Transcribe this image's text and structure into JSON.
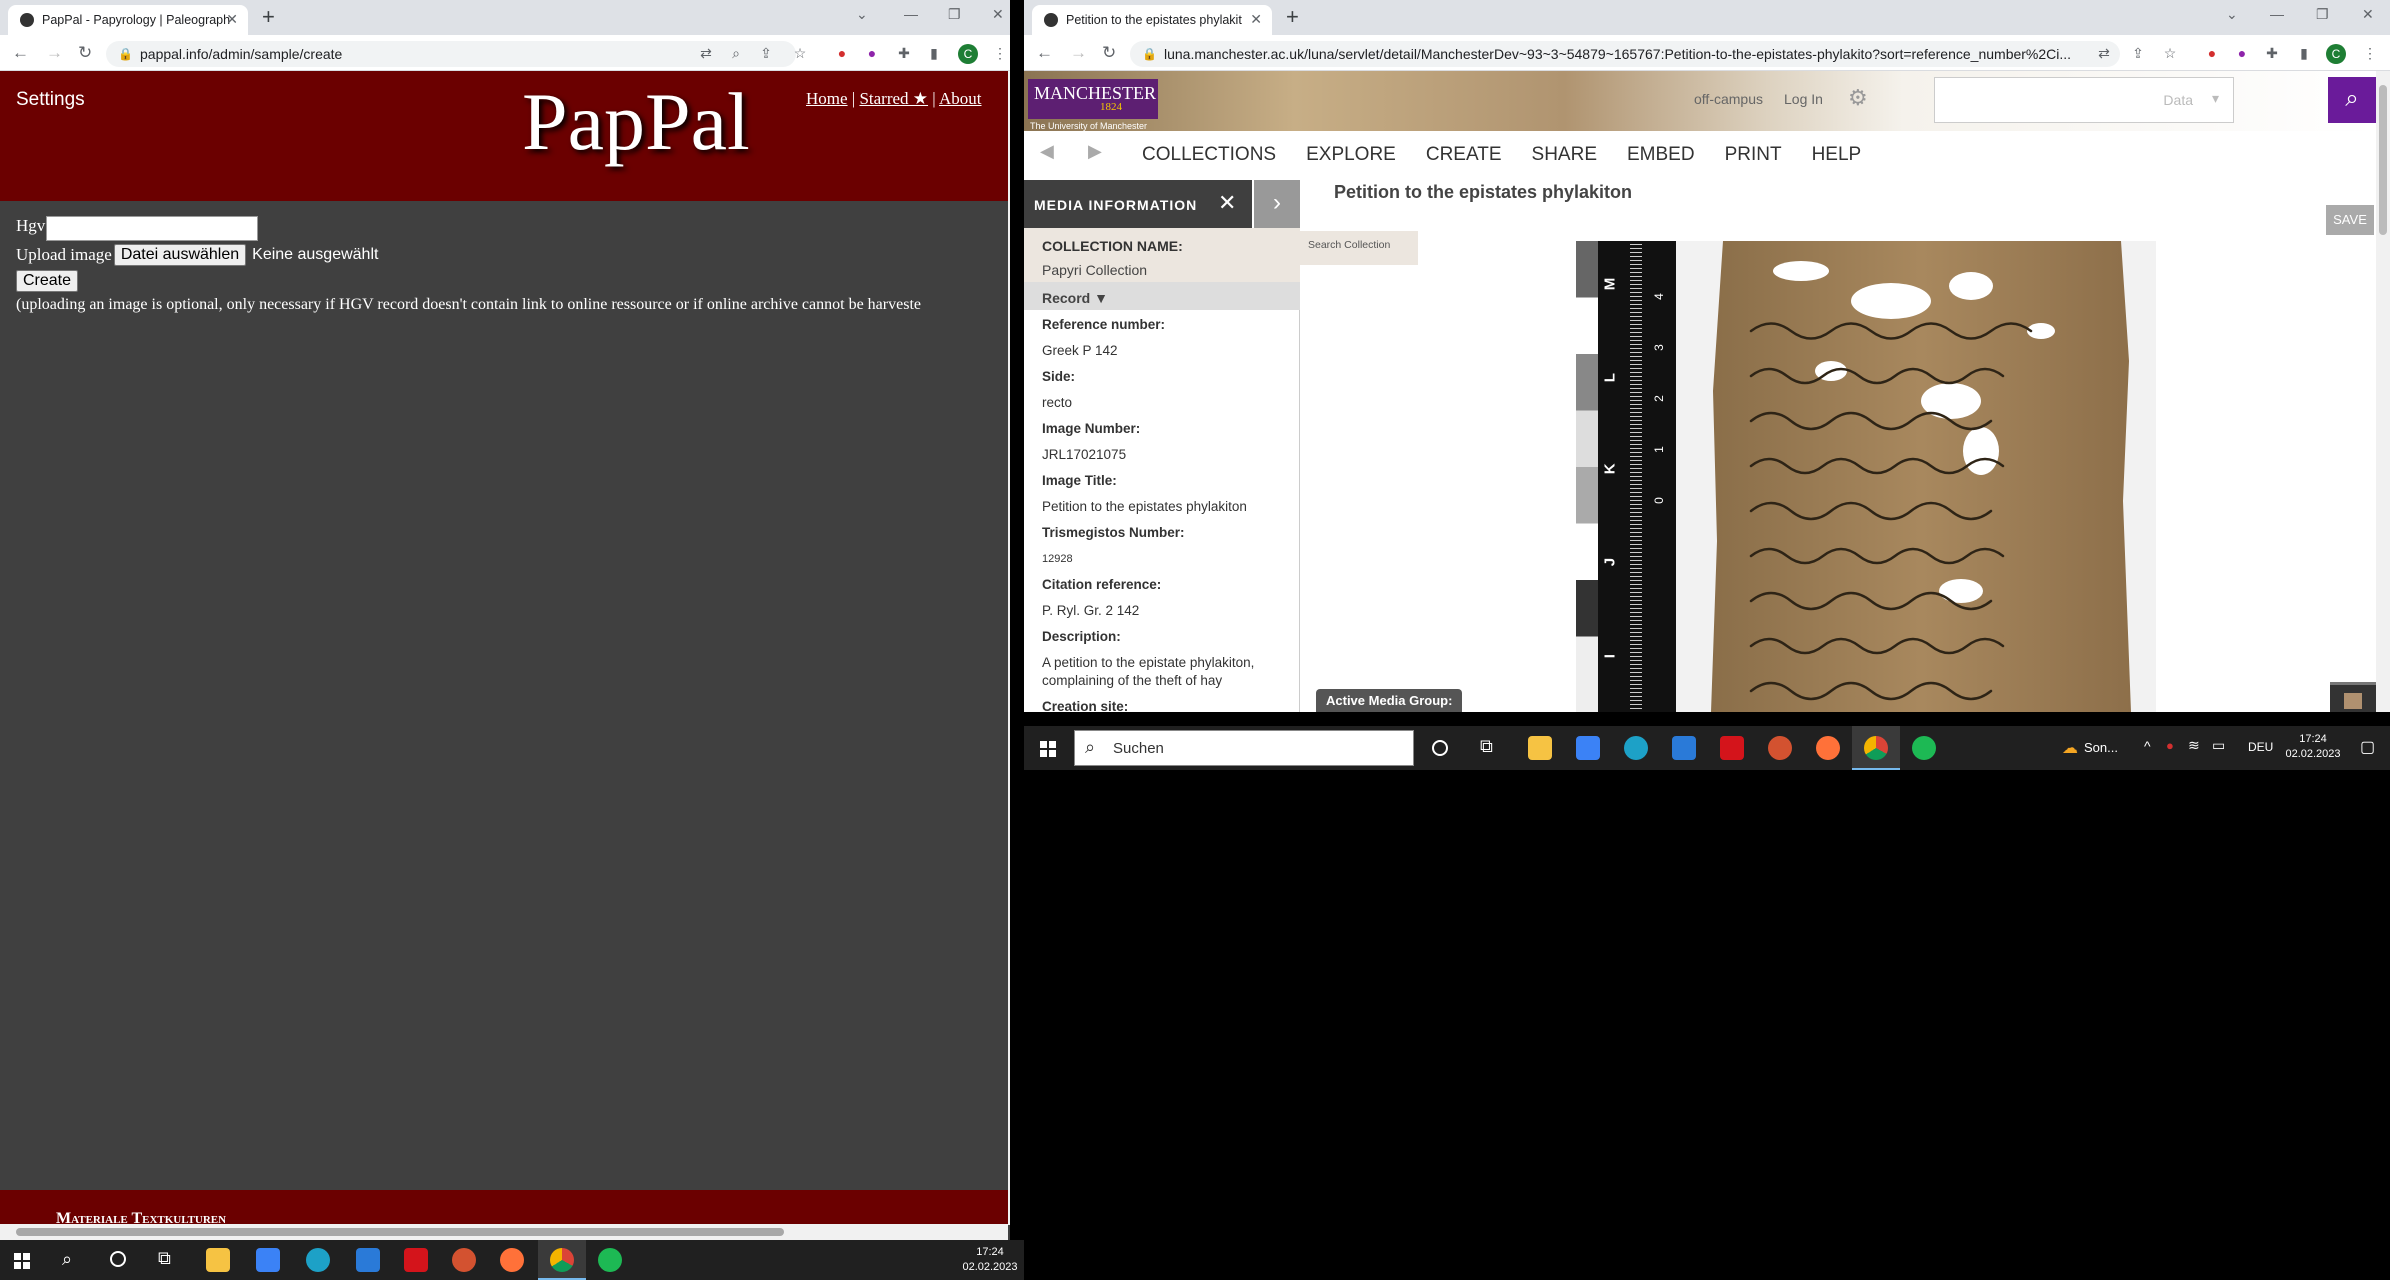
{
  "left_browser": {
    "tab_title": "PapPal - Papyrology | Paleograph",
    "url": "pappal.info/admin/sample/create",
    "page": {
      "settings_link": "Settings",
      "logo": "PapPal",
      "nav": [
        "Home",
        "Starred ★",
        "About"
      ],
      "hgv_label": "Hgv",
      "hgv_value": "",
      "upload_label": "Upload image",
      "file_button": "Datei auswählen",
      "file_status": "Keine ausgewählt",
      "create_button": "Create",
      "note": "(uploading an image is optional, only necessary if HGV record doesn't contain link to online ressource or if online archive cannot be harveste",
      "footer_text": "Materiale Textkulturen"
    },
    "colors": {
      "header": "#6b0000",
      "body": "#404040"
    }
  },
  "right_browser": {
    "tab_title": "Petition to the epistates phylakit",
    "url": "luna.manchester.ac.uk/luna/servlet/detail/ManchesterDev~93~3~54879~165767:Petition-to-the-epistates-phylakito?sort=reference_number%2Ci...",
    "header": {
      "logo_main": "MANCHESTER",
      "logo_year": "1824",
      "logo_sub": "The University of Manchester",
      "off_campus": "off-campus",
      "log_in": "Log In",
      "search_scope": "Data"
    },
    "menu": [
      "COLLECTIONS",
      "EXPLORE",
      "CREATE",
      "SHARE",
      "EMBED",
      "PRINT",
      "HELP"
    ],
    "panel_title": "MEDIA INFORMATION",
    "collection_label": "COLLECTION NAME:",
    "collection_value": "Papyri Collection",
    "record_toggle": "Record ▼",
    "fields": [
      {
        "label": "Reference number:",
        "value": "Greek P 142"
      },
      {
        "label": "Side:",
        "value": "recto"
      },
      {
        "label": "Image Number:",
        "value": "JRL17021075"
      },
      {
        "label": "Image Title:",
        "value": "Petition to the epistates phylakiton"
      },
      {
        "label": "Trismegistos Number:",
        "value": "12928"
      },
      {
        "label": "Citation reference:",
        "value": "P. Ryl. Gr. 2 142"
      },
      {
        "label": "Description:",
        "value": "A petition to the epistate phylakiton, complaining of the theft of hay"
      },
      {
        "label": "Creation site:",
        "value": ""
      }
    ],
    "search_collection": "Search Collection",
    "image_title": "Petition to the epistates phylakiton",
    "save_button": "SAVE",
    "active_media_group": "Active Media Group:",
    "ruler_letters": [
      "M",
      "L",
      "K",
      "J",
      "I"
    ],
    "ruler_numbers": [
      "4",
      "3",
      "2",
      "1",
      "0"
    ]
  },
  "taskbar_right": {
    "search_placeholder": "Suchen",
    "weather": "Son...",
    "language": "DEU",
    "time": "17:24",
    "date": "02.02.2023"
  },
  "taskbar_left": {
    "time": "17:24",
    "date": "02.02.2023"
  }
}
